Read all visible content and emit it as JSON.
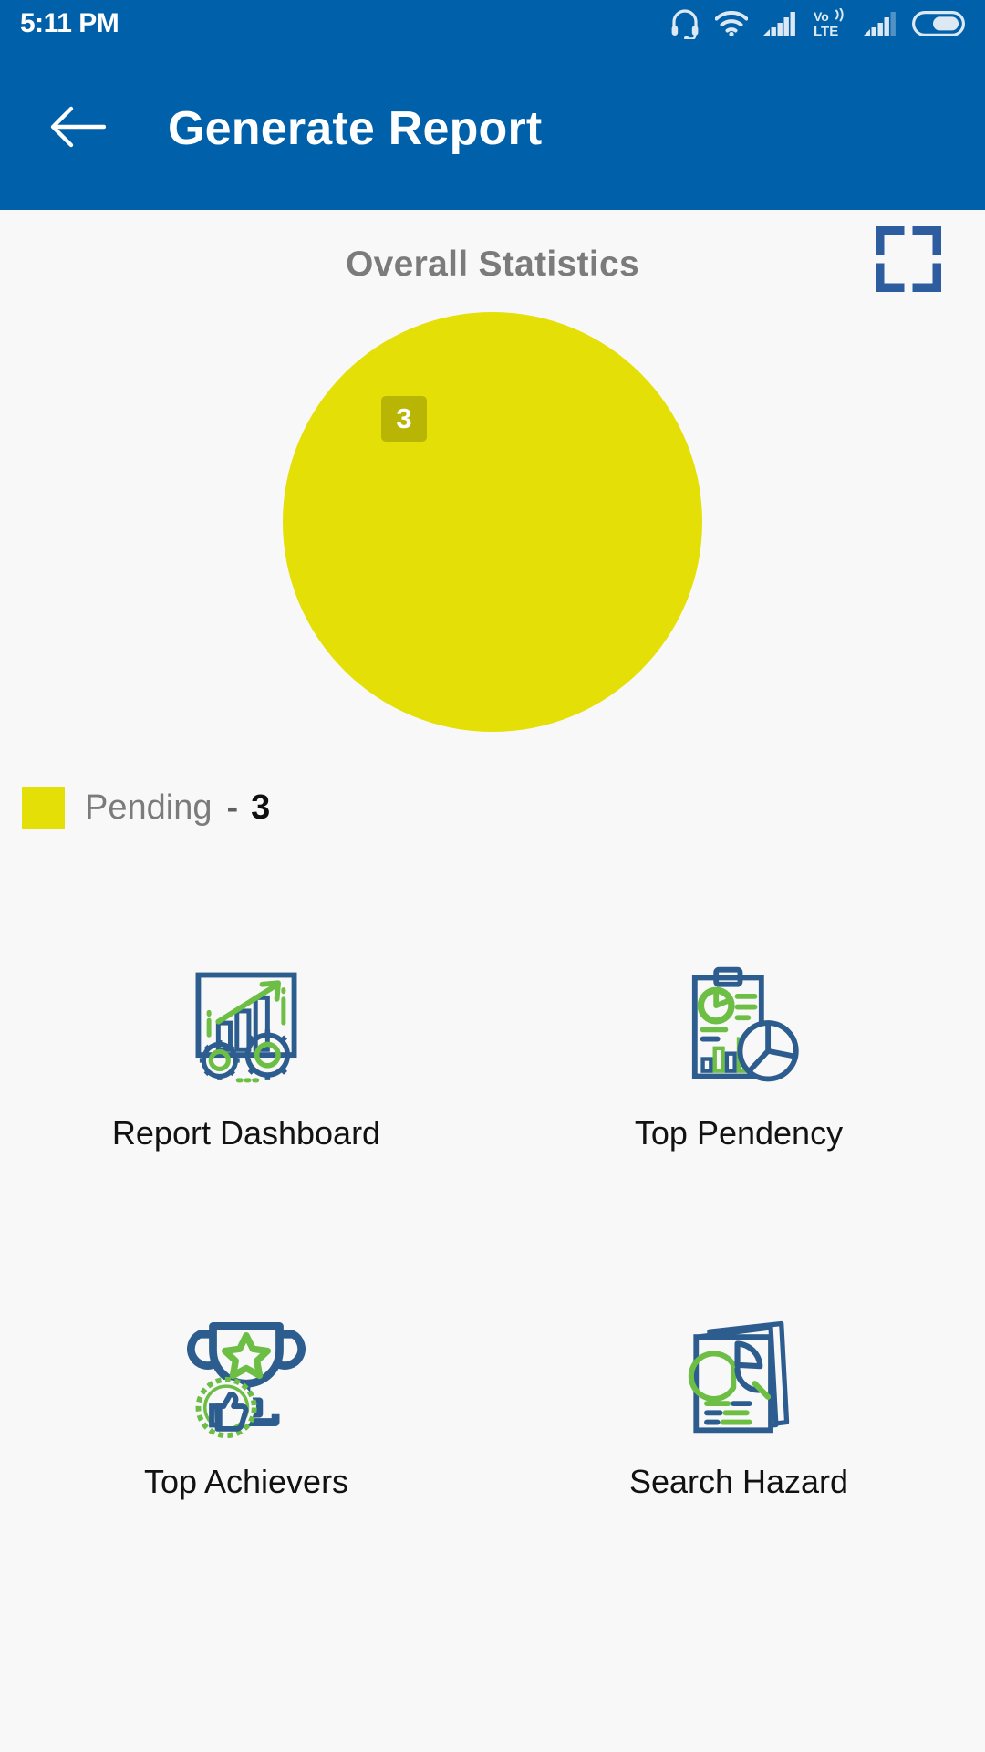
{
  "status_bar": {
    "time": "5:11 PM",
    "icons": [
      {
        "name": "headset-icon"
      },
      {
        "name": "wifi-icon"
      },
      {
        "name": "signal-bars-icon"
      },
      {
        "name": "volte-icon",
        "label_top": "Vo",
        "label_bottom": "LTE"
      },
      {
        "name": "signal-bars-secondary-icon"
      },
      {
        "name": "battery-icon"
      }
    ]
  },
  "app_bar": {
    "back_icon": "arrow-left-icon",
    "title": "Generate Report"
  },
  "chart_card": {
    "title": "Overall Statistics",
    "expand_icon": "fullscreen-expand-icon",
    "slice_label": "3",
    "legend": {
      "label": "Pending",
      "separator": "-",
      "value": "3"
    }
  },
  "chart_data": {
    "type": "pie",
    "title": "Overall Statistics",
    "categories": [
      "Pending"
    ],
    "values": [
      3
    ],
    "total": 3,
    "percentages": [
      100
    ],
    "data_labels": [
      "3"
    ],
    "colors": [
      "#e3df07"
    ],
    "legend_position": "bottom-left",
    "grid": false
  },
  "actions": [
    {
      "label": "Report Dashboard",
      "icon": "report-dashboard-icon"
    },
    {
      "label": "Top Pendency",
      "icon": "top-pendency-icon"
    },
    {
      "label": "Top Achievers",
      "icon": "top-achievers-icon"
    },
    {
      "label": "Search Hazard",
      "icon": "search-hazard-icon"
    }
  ],
  "colors": {
    "brand_blue": "#0060A9",
    "icon_blue": "#2d5d8e",
    "icon_green": "#6cbe45",
    "pie_yellow": "#e3df07",
    "pie_label_bg": "#b9b505",
    "expand_icon_blue": "#2d5d9e",
    "background": "#f8f8f8"
  }
}
